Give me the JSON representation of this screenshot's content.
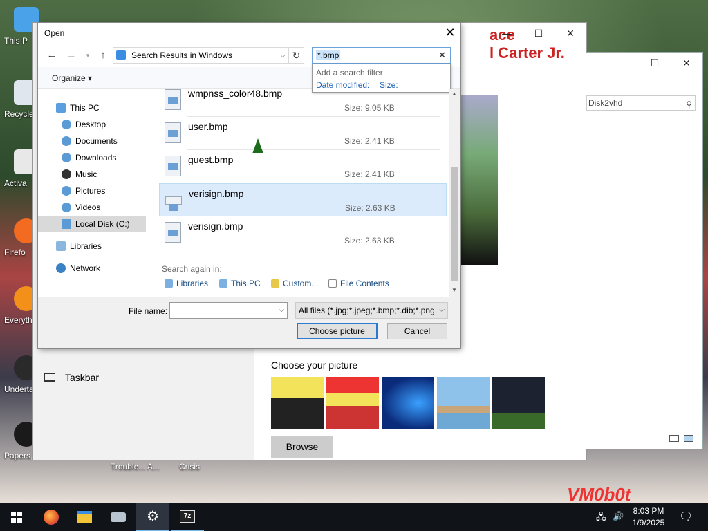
{
  "desktop": {
    "icons": [
      {
        "label": "This P"
      },
      {
        "label": "Recycle"
      },
      {
        "label": "Activa"
      },
      {
        "label": "Firefo"
      },
      {
        "label": "Everyth"
      },
      {
        "label": "Underta"
      },
      {
        "label": "Papers, P"
      }
    ],
    "under_labels": [
      "Trouble... A...",
      "Crisis"
    ],
    "watermark": "VM0b0t"
  },
  "settings_window": {
    "banner": "ace\nl Carter Jr.",
    "taskbar_item": "Taskbar",
    "choose_picture_title": "Choose your picture",
    "browse_label": "Browse",
    "minimize": "—",
    "maximize": "☐",
    "close": "✕"
  },
  "explorer_window": {
    "search_text": "Disk2vhd",
    "minimize": "—",
    "maximize": "☐",
    "close": "✕"
  },
  "dialog": {
    "title": "Open",
    "close": "✕",
    "address": "Search Results in Windows",
    "search_query": "*.bmp",
    "filter_popup": {
      "header": "Add a search filter",
      "options": [
        "Date modified:",
        "Size:"
      ]
    },
    "organize": "Organize ▾",
    "nav": [
      {
        "label": "This PC",
        "selected": false
      },
      {
        "label": "Desktop",
        "selected": false
      },
      {
        "label": "Documents",
        "selected": false
      },
      {
        "label": "Downloads",
        "selected": false
      },
      {
        "label": "Music",
        "selected": false
      },
      {
        "label": "Pictures",
        "selected": false
      },
      {
        "label": "Videos",
        "selected": false
      },
      {
        "label": "Local Disk (C:)",
        "selected": true
      },
      {
        "label": "Libraries",
        "selected": false
      },
      {
        "label": "Network",
        "selected": false
      }
    ],
    "results": [
      {
        "name": "wmpnss_color48.bmp",
        "size": "Size: 9.05 KB",
        "selected": false
      },
      {
        "name": "user.bmp",
        "size": "Size: 2.41 KB",
        "selected": false
      },
      {
        "name": "guest.bmp",
        "size": "Size: 2.41 KB",
        "selected": false
      },
      {
        "name": "verisign.bmp",
        "size": "Size: 2.63 KB",
        "selected": true
      },
      {
        "name": "verisign.bmp",
        "size": "Size: 2.63 KB",
        "selected": false
      }
    ],
    "search_again_label": "Search again in:",
    "search_again": [
      "Libraries",
      "This PC",
      "Custom...",
      "File Contents"
    ],
    "file_name_label": "File name:",
    "file_name_value": "",
    "file_type": "All files (*.jpg;*.jpeg;*.bmp;*.dib;*.png",
    "choose_button": "Choose picture",
    "cancel_button": "Cancel"
  },
  "taskbar": {
    "time": "8:03 PM",
    "date": "1/9/2025",
    "apps": [
      "start-icon",
      "firefox-icon",
      "file-explorer-icon",
      "scanner-icon",
      "settings-icon",
      "7zip-icon"
    ]
  },
  "colors": {
    "accent": "#2c79d0",
    "selection": "#dcebfb",
    "taskbar": "#101418"
  }
}
